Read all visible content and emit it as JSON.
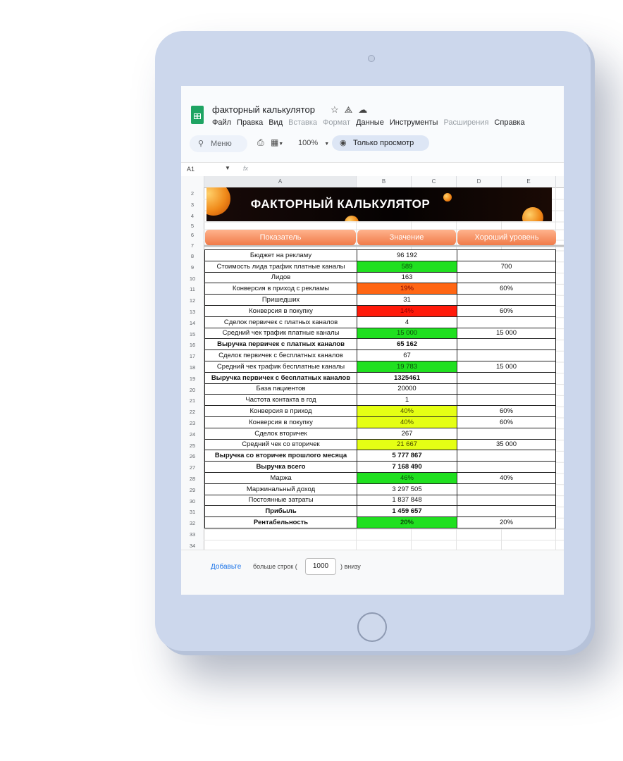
{
  "doc": {
    "title": "факторный калькулятор",
    "icons": [
      "star-icon",
      "drive-move-icon",
      "cloud-status-icon"
    ]
  },
  "menu": [
    "Файл",
    "Правка",
    "Вид",
    "Вставка",
    "Формат",
    "Данные",
    "Инструменты",
    "Расширения",
    "Справка"
  ],
  "menu_disabled": [
    "Вставка",
    "Формат",
    "Расширения"
  ],
  "toolbar": {
    "search_label": "Меню",
    "zoom": "100%",
    "view_only": "Только просмотр"
  },
  "formula_bar": {
    "cell_ref": "A1",
    "fx": "fx"
  },
  "columns": [
    "A",
    "B",
    "C",
    "D",
    "E"
  ],
  "row_numbers": [
    "2",
    "3",
    "4",
    "5",
    "6",
    "7",
    "8",
    "9",
    "10",
    "11",
    "12",
    "13",
    "14",
    "15",
    "16",
    "17",
    "18",
    "19",
    "20",
    "21",
    "22",
    "23",
    "24",
    "25",
    "26",
    "27",
    "28",
    "29",
    "30",
    "31",
    "32",
    "33",
    "34"
  ],
  "banner": {
    "title": "ФАКТОРНЫЙ КАЛЬКУЛЯТОР"
  },
  "headers": {
    "indicator": "Показатель",
    "value": "Значение",
    "good_level": "Хороший уровень"
  },
  "rows": [
    {
      "label": "Бюджет на рекламу",
      "value": "96 192",
      "good": "",
      "color": "",
      "bold": false
    },
    {
      "label": "Стоимость лида трафик платные каналы",
      "value": "589",
      "good": "700",
      "color": "green",
      "bold": false
    },
    {
      "label": "Лидов",
      "value": "163",
      "good": "",
      "color": "",
      "bold": false
    },
    {
      "label": "Конверсия в приход с рекламы",
      "value": "19%",
      "good": "60%",
      "color": "orange",
      "bold": false
    },
    {
      "label": "Пришедших",
      "value": "31",
      "good": "",
      "color": "",
      "bold": false
    },
    {
      "label": "Конверсия в покупку",
      "value": "14%",
      "good": "60%",
      "color": "red",
      "bold": false
    },
    {
      "label": "Сделок первичек с платных каналов",
      "value": "4",
      "good": "",
      "color": "",
      "bold": false
    },
    {
      "label": "Средний чек трафик платные каналы",
      "value": "15 000",
      "good": "15 000",
      "color": "green",
      "bold": false
    },
    {
      "label": "Выручка первичек с платных каналов",
      "value": "65 162",
      "good": "",
      "color": "",
      "bold": true
    },
    {
      "label": "Сделок первичек с бесплатных каналов",
      "value": "67",
      "good": "",
      "color": "",
      "bold": false
    },
    {
      "label": "Средний чек трафик бесплатные каналы",
      "value": "19 783",
      "good": "15 000",
      "color": "green",
      "bold": false
    },
    {
      "label": "Выручка первичек с бесплатных каналов",
      "value": "1325461",
      "good": "",
      "color": "",
      "bold": true
    },
    {
      "label": "База пациентов",
      "value": "20000",
      "good": "",
      "color": "",
      "bold": false
    },
    {
      "label": "Частота контакта в год",
      "value": "1",
      "good": "",
      "color": "",
      "bold": false
    },
    {
      "label": "Конверсия в приход",
      "value": "40%",
      "good": "60%",
      "color": "yellow",
      "bold": false
    },
    {
      "label": "Конверсия в покупку",
      "value": "40%",
      "good": "60%",
      "color": "yellow",
      "bold": false
    },
    {
      "label": "Сделок вторичек",
      "value": "267",
      "good": "",
      "color": "",
      "bold": false
    },
    {
      "label": "Средний чек со вторичек",
      "value": "21 667",
      "good": "35 000",
      "color": "yellow",
      "bold": false
    },
    {
      "label": "Выручка со вторичек прошлого месяца",
      "value": "5 777 867",
      "good": "",
      "color": "",
      "bold": true
    },
    {
      "label": "Выручка всего",
      "value": "7 168 490",
      "good": "",
      "color": "",
      "bold": true
    },
    {
      "label": "Маржа",
      "value": "46%",
      "good": "40%",
      "color": "green",
      "bold": false
    },
    {
      "label": "Маржинальный доход",
      "value": "3 297 505",
      "good": "",
      "color": "",
      "bold": false
    },
    {
      "label": "Постоянные затраты",
      "value": "1 837 848",
      "good": "",
      "color": "",
      "bold": false
    },
    {
      "label": "Прибыль",
      "value": "1 459 657",
      "good": "",
      "color": "",
      "bold": true
    },
    {
      "label": "Рентабельность",
      "value": "20%",
      "good": "20%",
      "color": "green",
      "bold": true
    }
  ],
  "footer": {
    "add_label": "Добавьте",
    "more_label": "больше строк (",
    "rows_value": "1000",
    "bottom_label": ") внизу"
  },
  "colors": {
    "green": "#20e020",
    "orange": "#ff6614",
    "red": "#ff1a0a",
    "yellow": "#e5ff14",
    "accent": "#1a73e8"
  }
}
